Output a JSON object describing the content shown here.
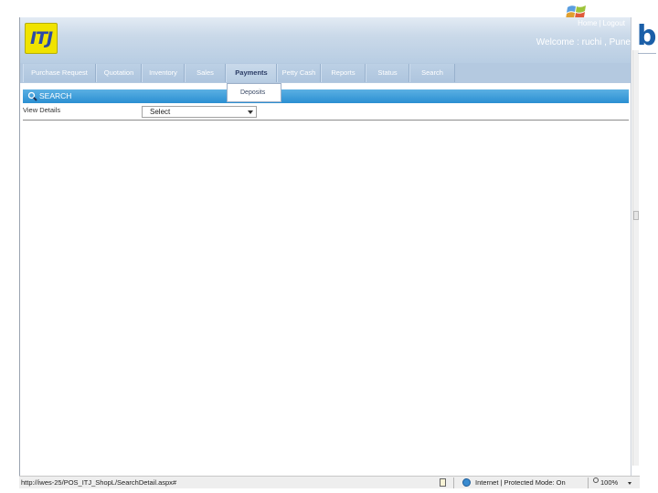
{
  "header": {
    "logo_text": "ITJ",
    "links": {
      "home": "Home",
      "separator": "|",
      "logout": "Logout"
    },
    "welcome": "Welcome : ruchi , Pune"
  },
  "nav": {
    "items": [
      {
        "label": "Purchase Request"
      },
      {
        "label": "Quotation"
      },
      {
        "label": "Inventory"
      },
      {
        "label": "Sales"
      },
      {
        "label": "Payments",
        "active": true
      },
      {
        "label": "Petty Cash"
      },
      {
        "label": "Reports"
      },
      {
        "label": "Status"
      },
      {
        "label": "Search"
      }
    ],
    "dropdown_item": "Deposits"
  },
  "section": {
    "title": "SEARCH",
    "view_label": "View Details",
    "select_value": "Select"
  },
  "statusbar": {
    "url": "http://iwes-25/POS_ITJ_ShopL/SearchDetail.aspx#",
    "zone": "Internet | Protected Mode: On",
    "zoom": "100%"
  },
  "colors": {
    "header_gradient_end": "#b8cde3",
    "section_bar": "#2a8fd2",
    "logo_yellow": "#f0e300",
    "logo_blue": "#2c4aa8"
  }
}
